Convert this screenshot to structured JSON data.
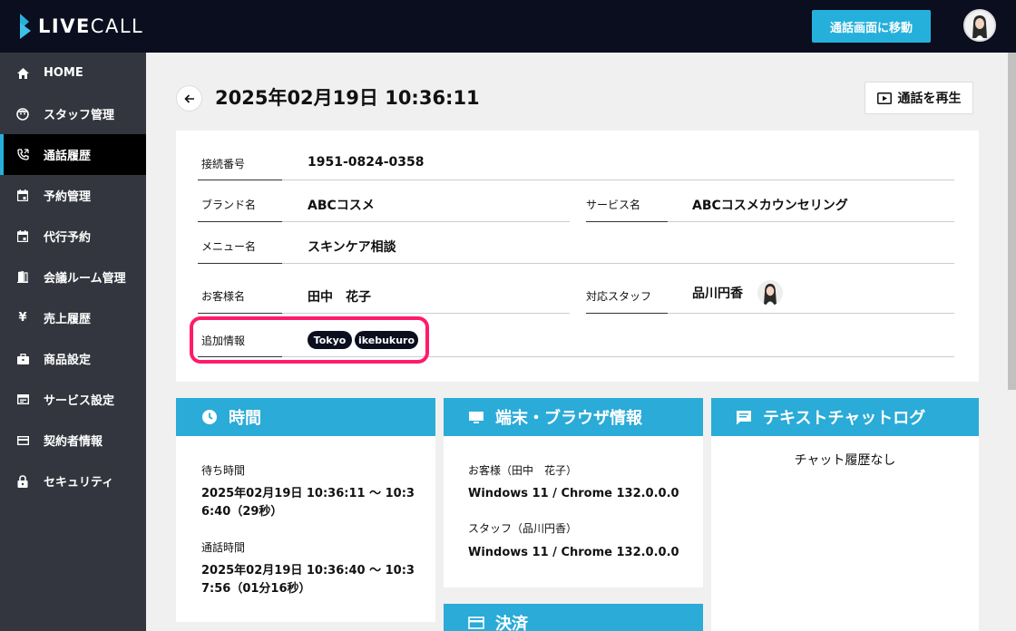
{
  "header": {
    "logo_bold": "LIVE",
    "logo_light": "CALL",
    "move_button": "通話画面に移動"
  },
  "sidebar": {
    "items": [
      {
        "label": "HOME",
        "icon": "home-icon"
      },
      {
        "label": "スタッフ管理",
        "icon": "staff-icon"
      },
      {
        "label": "通話履歴",
        "icon": "phone-icon",
        "active": true
      },
      {
        "label": "予約管理",
        "icon": "calendar-icon"
      },
      {
        "label": "代行予約",
        "icon": "calendar-icon"
      },
      {
        "label": "会議ルーム管理",
        "icon": "door-icon"
      },
      {
        "label": "売上履歴",
        "icon": "yen-icon"
      },
      {
        "label": "商品設定",
        "icon": "briefcase-icon"
      },
      {
        "label": "サービス設定",
        "icon": "service-icon"
      },
      {
        "label": "契約者情報",
        "icon": "card-icon"
      },
      {
        "label": "セキュリティ",
        "icon": "lock-icon"
      }
    ]
  },
  "page": {
    "title": "2025年02月19日 10:36:11",
    "replay_button": "通話を再生"
  },
  "details": {
    "connection_label": "接続番号",
    "connection_value": "1951-0824-0358",
    "brand_label": "ブランド名",
    "brand_value": "ABCコスメ",
    "service_label": "サービス名",
    "service_value": "ABCコスメカウンセリング",
    "menu_label": "メニュー名",
    "menu_value": "スキンケア相談",
    "customer_label": "お客様名",
    "customer_value": "田中　花子",
    "staff_label": "対応スタッフ",
    "staff_value": "品川円香",
    "extra_label": "追加情報",
    "tags": [
      "Tokyo",
      "ikebukuro"
    ]
  },
  "time_panel": {
    "title": "時間",
    "wait_label": "待ち時間",
    "wait_line1": "2025年02月19日 10:36:11 〜 10:3",
    "wait_line2": "6:40（29秒）",
    "call_label": "通話時間",
    "call_line1": "2025年02月19日 10:36:40 〜 10:3",
    "call_line2": "7:56（01分16秒）"
  },
  "device_panel": {
    "title": "端末・ブラウザ情報",
    "customer_label": "お客様（田中　花子）",
    "customer_value": "Windows 11 / Chrome 132.0.0.0",
    "staff_label": "スタッフ（品川円香）",
    "staff_value": "Windows 11 / Chrome 132.0.0.0"
  },
  "chat_panel": {
    "title": "テキストチャットログ",
    "empty_text": "チャット履歴なし"
  },
  "payment_panel": {
    "title": "決済"
  },
  "colors": {
    "accent": "#2aabd8",
    "topbar": "#0b0e1e",
    "sidebar": "#33363f",
    "highlight": "#ff1a6b"
  }
}
